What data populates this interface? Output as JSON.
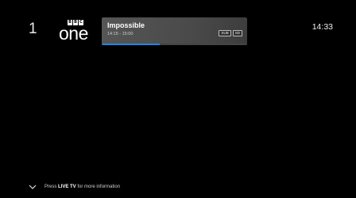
{
  "channel": {
    "number": "1",
    "logo_top": [
      "B",
      "B",
      "C"
    ],
    "logo_bottom": "one"
  },
  "program": {
    "title": "Impossible",
    "time": "14:15 - 15:00",
    "badges": [
      "SUB",
      "SD"
    ],
    "progress": 0.4
  },
  "clock": "14:33",
  "footer": {
    "prefix": "Press ",
    "key": "LIVE TV",
    "suffix": " for more information",
    "icon": "chevron-down-icon"
  },
  "colors": {
    "progress": "#1e88e5",
    "background": "#000000"
  }
}
